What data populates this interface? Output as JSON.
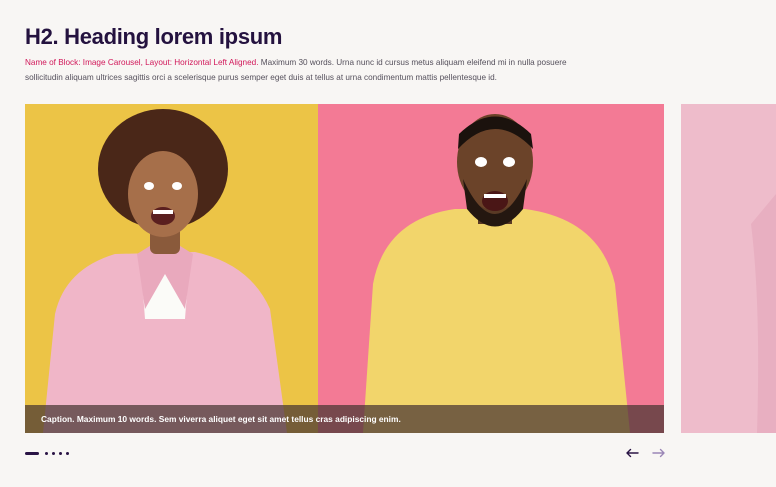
{
  "heading": "H2. Heading lorem ipsum",
  "description": {
    "accent": "Name of Block: Image Carousel, Layout: Horizontal Left Aligned.",
    "text": " Maximum 30 words. Urna nunc id cursus metus aliquam eleifend mi in nulla posuere sollicitudin aliquam ultrices sagittis orci a scelerisque purus semper eget duis at tellus at urna condimentum mattis pellentesque id."
  },
  "carousel": {
    "caption": "Caption. Maximum 10 words. Sem viverra aliquet eget sit amet tellus cras adipiscing enim.",
    "slides_count": 5,
    "active_index": 0
  },
  "nav": {
    "prev_icon": "arrow-left-icon",
    "next_icon": "arrow-right-icon"
  },
  "colors": {
    "heading": "#24123f",
    "accent": "#d1185a",
    "background": "#f8f6f4",
    "slide_yellow": "#ecc446",
    "slide_pink": "#f37a95",
    "slide_next": "#eebccb"
  }
}
